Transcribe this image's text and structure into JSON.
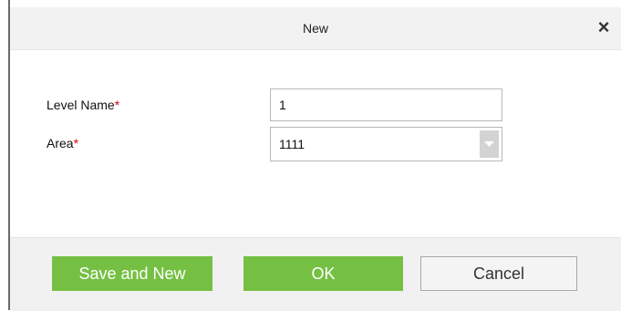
{
  "dialog": {
    "title": "New",
    "close_label": "×"
  },
  "form": {
    "level_name": {
      "label": "Level Name",
      "required_mark": "*",
      "value": "1"
    },
    "area": {
      "label": "Area",
      "required_mark": "*",
      "value": "1111"
    }
  },
  "buttons": {
    "save_and_new": "Save and New",
    "ok": "OK",
    "cancel": "Cancel"
  },
  "colors": {
    "primary_button": "#75c043",
    "required_mark": "#e00000"
  }
}
